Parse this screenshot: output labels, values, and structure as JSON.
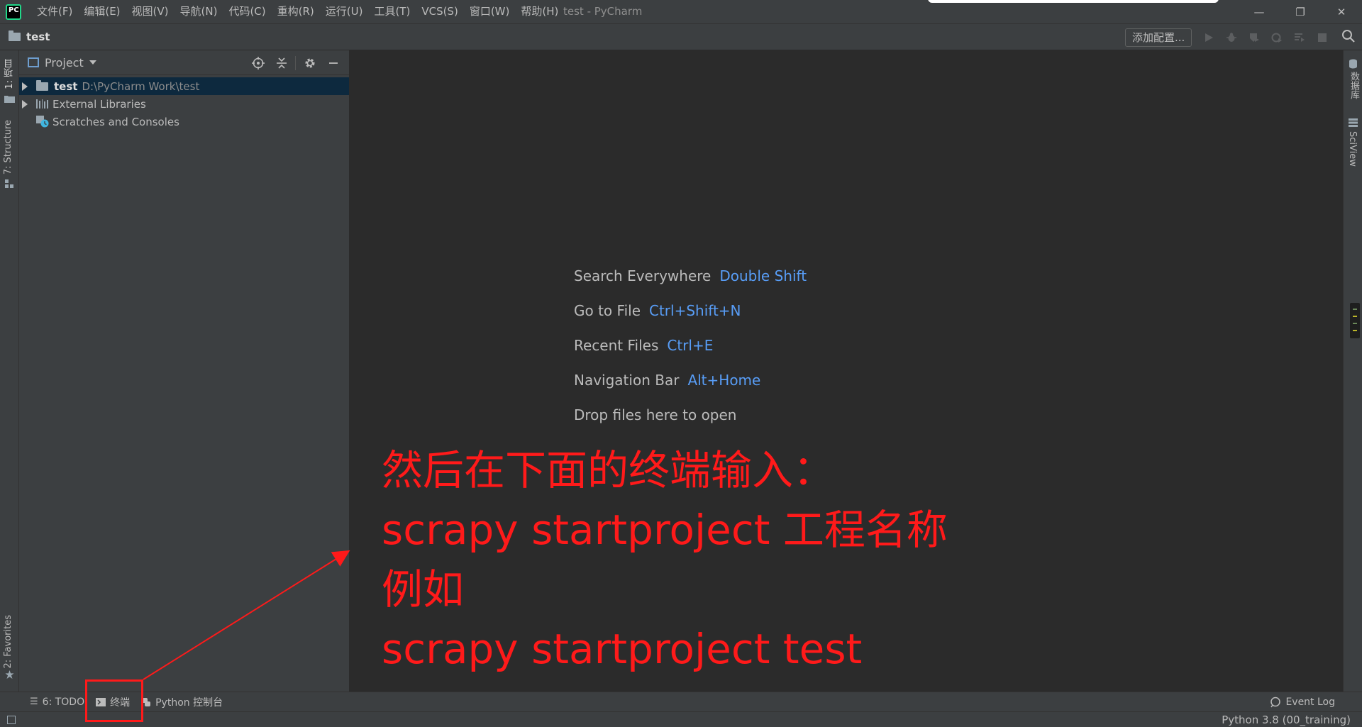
{
  "titlebar": {
    "app_icon_label": "PC",
    "window_title": "test - PyCharm",
    "menu": [
      "文件(F)",
      "编辑(E)",
      "视图(V)",
      "导航(N)",
      "代码(C)",
      "重构(R)",
      "运行(U)",
      "工具(T)",
      "VCS(S)",
      "窗口(W)",
      "帮助(H)"
    ],
    "controls": {
      "minimize": "—",
      "restore": "❐",
      "close": "✕"
    }
  },
  "navbar": {
    "breadcrumb": "test",
    "add_config_label": "添加配置...",
    "toolbar_icons": [
      "run-icon",
      "debug-icon",
      "coverage-icon",
      "profile-icon",
      "concurrency-icon",
      "stop-icon"
    ]
  },
  "left_strip": {
    "tabs": [
      "1: 项目",
      "7: Structure",
      "2: Favorites"
    ]
  },
  "project_panel": {
    "title": "Project",
    "tree": [
      {
        "label": "test",
        "path": "D:\\PyCharm Work\\test",
        "expandable": true,
        "selected": true
      },
      {
        "label": "External Libraries",
        "path": "",
        "expandable": true,
        "selected": false
      },
      {
        "label": "Scratches and Consoles",
        "path": "",
        "expandable": false,
        "selected": false
      }
    ]
  },
  "editor": {
    "hints": [
      {
        "label": "Search Everywhere",
        "key": "Double Shift"
      },
      {
        "label": "Go to File",
        "key": "Ctrl+Shift+N"
      },
      {
        "label": "Recent Files",
        "key": "Ctrl+E"
      },
      {
        "label": "Navigation Bar",
        "key": "Alt+Home"
      },
      {
        "label": "Drop files here to open",
        "key": ""
      }
    ],
    "annotation_lines": [
      "然后在下面的终端输入：",
      "scrapy startproject 工程名称",
      "例如",
      "scrapy startproject test"
    ]
  },
  "right_strip": {
    "tabs": [
      "数据库",
      "SciView"
    ]
  },
  "bottom_bar": {
    "tabs": [
      {
        "label": "6: TODO",
        "icon": "list-icon"
      },
      {
        "label": "终端",
        "icon": "terminal-icon"
      },
      {
        "label": "Python 控制台",
        "icon": "python-icon"
      }
    ],
    "event_log": "Event Log"
  },
  "status_bar": {
    "interpreter": "Python 3.8 (00_training)"
  },
  "colors": {
    "accent_blue": "#589df6",
    "annotation_red": "#ff1a1a",
    "selection": "#0d293e"
  }
}
